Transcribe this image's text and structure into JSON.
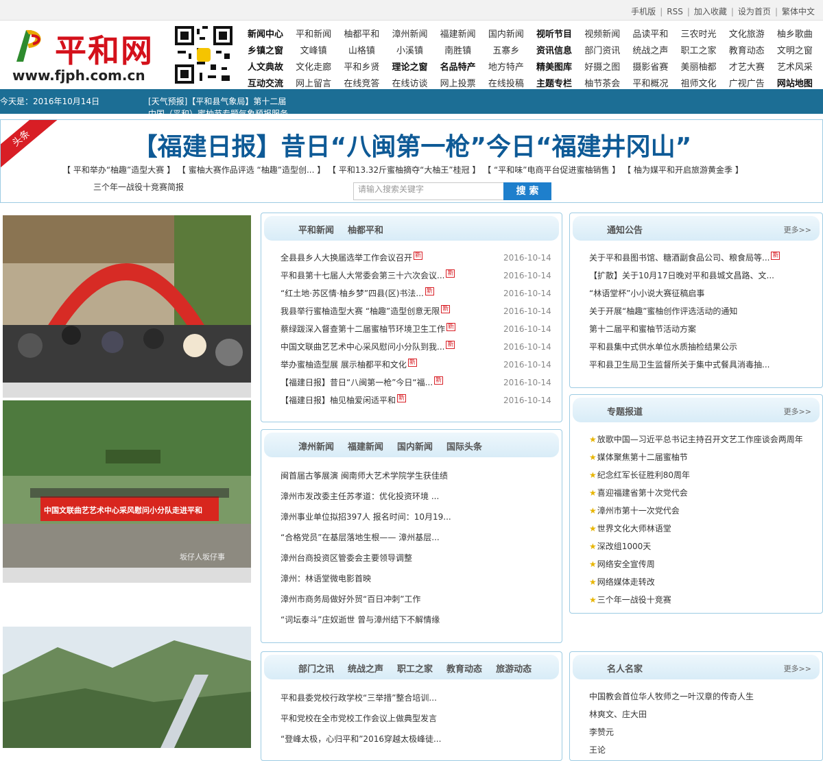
{
  "toplinks": [
    "手机版",
    "RSS",
    "加入收藏",
    "设为首页",
    "繁体中文"
  ],
  "logo": {
    "name": "平和网",
    "url": "www.fjph.com.cn"
  },
  "nav": [
    [
      {
        "label": "新闻中心",
        "bold": true
      },
      {
        "label": "平和新闻"
      },
      {
        "label": "柚都平和"
      },
      {
        "label": "漳州新闻"
      },
      {
        "label": "福建新闻"
      },
      {
        "label": "国内新闻"
      },
      {
        "label": "视听节目",
        "bold": true
      },
      {
        "label": "视频新闻"
      },
      {
        "label": "品读平和"
      },
      {
        "label": "三农时光"
      },
      {
        "label": "文化旅游"
      },
      {
        "label": "柚乡歌曲"
      }
    ],
    [
      {
        "label": "乡镇之窗",
        "bold": true
      },
      {
        "label": "文峰镇"
      },
      {
        "label": "山格镇"
      },
      {
        "label": "小溪镇"
      },
      {
        "label": "南胜镇"
      },
      {
        "label": "五寨乡"
      },
      {
        "label": "资讯信息",
        "bold": true
      },
      {
        "label": "部门资讯"
      },
      {
        "label": "统战之声"
      },
      {
        "label": "职工之家"
      },
      {
        "label": "教育动态"
      },
      {
        "label": "文明之窗"
      }
    ],
    [
      {
        "label": "人文典故",
        "bold": true
      },
      {
        "label": "文化走廊"
      },
      {
        "label": "平和乡贤"
      },
      {
        "label": "理论之窗",
        "bold": true
      },
      {
        "label": "名品特产",
        "bold": true
      },
      {
        "label": "地方特产"
      },
      {
        "label": "精美图库",
        "bold": true
      },
      {
        "label": "好摄之图"
      },
      {
        "label": "摄影省赛"
      },
      {
        "label": "美丽柚都"
      },
      {
        "label": "才艺大赛"
      },
      {
        "label": "艺术风采"
      }
    ],
    [
      {
        "label": "互动交流",
        "bold": true
      },
      {
        "label": "网上留言"
      },
      {
        "label": "在线竞答"
      },
      {
        "label": "在线访谈"
      },
      {
        "label": "网上投票"
      },
      {
        "label": "在线投稿"
      },
      {
        "label": "主题专栏",
        "bold": true
      },
      {
        "label": "柚节茶会"
      },
      {
        "label": "平和概况"
      },
      {
        "label": "祖师文化"
      },
      {
        "label": "广视广告"
      },
      {
        "label": "网站地图",
        "bold": true
      }
    ]
  ],
  "datebar": {
    "date": "今天是：2016年10月14日",
    "weather": "[天气预报]【平和县气象局】第十二届",
    "weather2": "中国（平和）蜜柚节专题气象预报服务"
  },
  "headline": {
    "ribbon": "头条",
    "title": "【福建日报】昔日“八闽第一枪”今日“福建井冈山”",
    "links": "【 平和举办“柚趣”造型大赛 】 【 蜜柚大赛作品评选 “柚趣”造型创... 】 【 平和13.32斤蜜柚摘夺“大柚王”桂冠 】 【 “平和味”电商平台促进蜜柚销售 】 【 柚为媒平和开启旅游黄金季 】",
    "links2": "三个年一战役十竞赛简报",
    "search_placeholder": "请输入搜索关键字",
    "search_button": "搜 索"
  },
  "photos": {
    "banner_text": "中国文联曲艺艺术中心采风慰问小分队走进平和",
    "watermark": "坂仔人坂仔事"
  },
  "panels": {
    "news": {
      "tabs": [
        "平和新闻",
        "柚都平和"
      ],
      "items": [
        {
          "title": "全县县乡人大换届选举工作会议召开",
          "new": true,
          "date": "2016-10-14"
        },
        {
          "title": "平和县第十七届人大常委会第三十六次会议...",
          "new": true,
          "date": "2016-10-14"
        },
        {
          "title": "“红土地·苏区情·柚乡梦”四县(区)书法...",
          "new": true,
          "date": "2016-10-14"
        },
        {
          "title": "我县举行蜜柚造型大赛 “柚趣”造型创意无限",
          "new": true,
          "date": "2016-10-14"
        },
        {
          "title": "蔡绿跋深入督查第十二届蜜柚节环境卫生工作",
          "new": true,
          "date": "2016-10-14"
        },
        {
          "title": "中国文联曲艺艺术中心采风慰问小分队到我...",
          "new": true,
          "date": "2016-10-14"
        },
        {
          "title": "举办蜜柚造型展 展示柚都平和文化",
          "new": true,
          "date": "2016-10-14"
        },
        {
          "title": "【福建日报】昔日“八闽第一枪”今日“福...",
          "new": true,
          "date": "2016-10-14"
        },
        {
          "title": "【福建日报】柚见柚爱闲适平和",
          "new": true,
          "date": "2016-10-14"
        }
      ]
    },
    "notice": {
      "tabs": [
        "通知公告"
      ],
      "more": "更多>>",
      "items": [
        {
          "title": "关于平和县图书馆、糖酒副食品公司、粮食局等...",
          "new": true
        },
        {
          "title": "【扩散】关于10月17日晚对平和县城文昌路、文..."
        },
        {
          "title": "“林语堂杯”小小说大赛征稿启事"
        },
        {
          "title": "关于开展“柚趣”蜜柚创作评选活动的通知"
        },
        {
          "title": "第十二届平和蜜柚节活动方案"
        },
        {
          "title": "平和县集中式供水单位水质抽检结果公示"
        },
        {
          "title": "平和县卫生局卫生监督所关于集中式餐具消毒抽..."
        }
      ]
    },
    "zhangzhou": {
      "tabs": [
        "漳州新闻",
        "福建新闻",
        "国内新闻",
        "国际头条"
      ],
      "items": [
        "闽首届古筝展演 闽南师大艺术学院学生获佳绩",
        "漳州市发改委主任苏孝道：优化投资环境 ...",
        "漳州事业单位拟招397人 报名时间：10月19...",
        "“合格党员”在基层落地生根—— 漳州基层...",
        "漳州台商投资区管委会主要领导调整",
        "漳州：林语堂微电影首映",
        "漳州市商务局做好外贸“百日冲刺”工作",
        "“词坛泰斗”庄奴逝世 曾与漳州结下不解情缘"
      ]
    },
    "special": {
      "tabs": [
        "专题报道"
      ],
      "more": "更多>>",
      "items": [
        "放歌中国—习近平总书记主持召开文艺工作座谈会两周年",
        "媒体聚焦第十二届蜜柚节",
        "纪念红军长征胜利80周年",
        "喜迎福建省第十次党代会",
        "漳州市第十一次党代会",
        "世界文化大师林语堂",
        "深改组1000天",
        "网络安全宣传周",
        "网络媒体走转改",
        "三个年一战役十竞赛"
      ]
    },
    "dept": {
      "tabs": [
        "部门之讯",
        "统战之声",
        "职工之家",
        "教育动态",
        "旅游动态"
      ],
      "items": [
        "平和县委党校行政学校“三举措”整合培训...",
        "平和党校在全市党校工作会议上做典型发言",
        "“登峰太极，心归平和”2016穿越太极峰徒..."
      ]
    },
    "famous": {
      "tabs": [
        "名人名家"
      ],
      "more": "更多>>",
      "items": [
        "中国教会首位华人牧师之一叶汉章的传奇人生",
        "林爽文、庄大田",
        "李赞元",
        "王论"
      ]
    }
  },
  "colors": {
    "brand_red": "#d4111b",
    "bar_blue": "#1c6e95",
    "headline_blue": "#0e5a96"
  }
}
